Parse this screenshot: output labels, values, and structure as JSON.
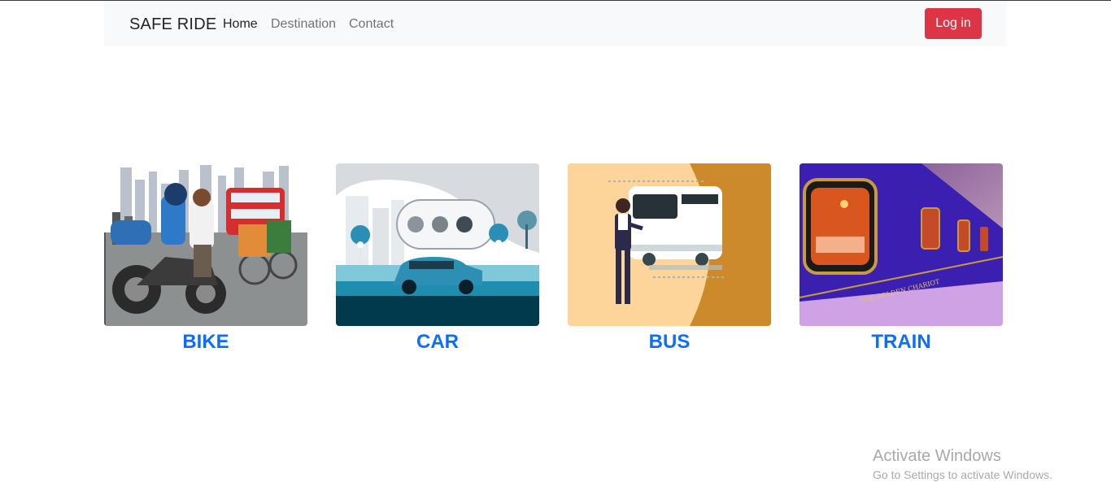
{
  "navbar": {
    "brand": "SAFE RIDE",
    "links": [
      {
        "label": "Home",
        "active": true
      },
      {
        "label": "Destination",
        "active": false
      },
      {
        "label": "Contact",
        "active": false
      }
    ],
    "login_label": "Log in",
    "login_color": "#dc3545"
  },
  "cards": [
    {
      "label": "BIKE",
      "image": "bike-illustration"
    },
    {
      "label": "CAR",
      "image": "car-illustration"
    },
    {
      "label": "BUS",
      "image": "bus-illustration"
    },
    {
      "label": "TRAIN",
      "image": "train-photo"
    }
  ],
  "train_sign": "THE GOLDEN CHARIOT",
  "watermark": {
    "title": "Activate Windows",
    "subtitle": "Go to Settings to activate Windows."
  },
  "colors": {
    "link_blue": "#0d6efd",
    "navbar_bg": "#f8f9fa"
  }
}
